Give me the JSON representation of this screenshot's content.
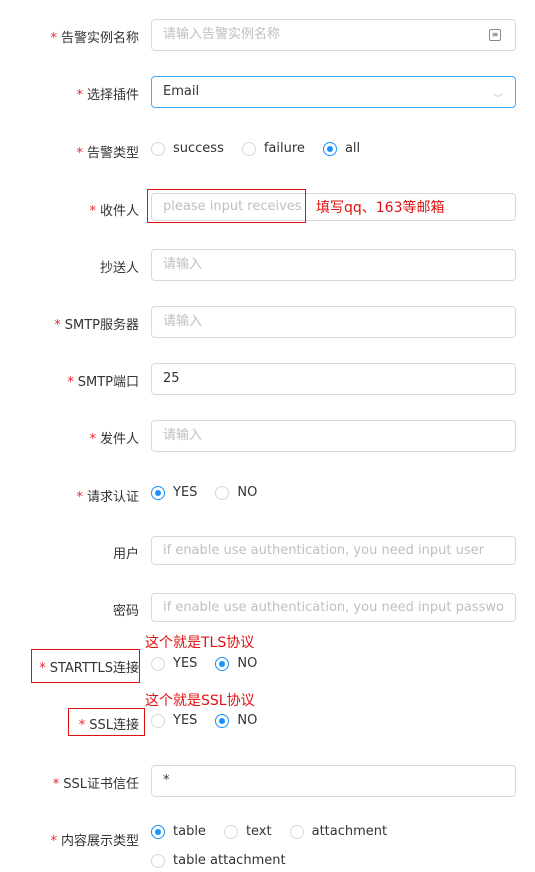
{
  "form": {
    "required_mark": "*",
    "alert_name": {
      "label": "告警实例名称",
      "placeholder": "请输入告警实例名称"
    },
    "plugin": {
      "label": "选择插件",
      "value": "Email"
    },
    "alert_type": {
      "label": "告警类型",
      "options": [
        "success",
        "failure",
        "all"
      ],
      "selected": "all"
    },
    "receivers": {
      "label": "收件人",
      "placeholder": "please input receives"
    },
    "cc": {
      "label": "抄送人",
      "placeholder": "请输入"
    },
    "smtp_server": {
      "label": "SMTP服务器",
      "placeholder": "请输入"
    },
    "smtp_port": {
      "label": "SMTP端口",
      "value": "25"
    },
    "sender": {
      "label": "发件人",
      "placeholder": "请输入"
    },
    "auth": {
      "label": "请求认证",
      "options": [
        "YES",
        "NO"
      ],
      "selected": "YES"
    },
    "user": {
      "label": "用户",
      "placeholder": "if enable use authentication, you need input user"
    },
    "password": {
      "label": "密码",
      "placeholder": "if enable use authentication, you need input passwo"
    },
    "starttls": {
      "label": "STARTTLS连接",
      "options": [
        "YES",
        "NO"
      ],
      "selected": "NO"
    },
    "ssl": {
      "label": "SSL连接",
      "options": [
        "YES",
        "NO"
      ],
      "selected": "NO"
    },
    "ssl_trust": {
      "label": "SSL证书信任",
      "value": "*"
    },
    "content_type": {
      "label": "内容展示类型",
      "options": [
        "table",
        "text",
        "attachment",
        "table attachment"
      ],
      "selected": "table"
    }
  },
  "annotations": {
    "receivers_note": "填写qq、163等邮箱",
    "tls_note": "这个就是TLS协议",
    "ssl_note": "这个就是SSL协议"
  },
  "colors": {
    "annotation": "#e01010",
    "accent": "#1890ff",
    "required": "#f5222d"
  }
}
